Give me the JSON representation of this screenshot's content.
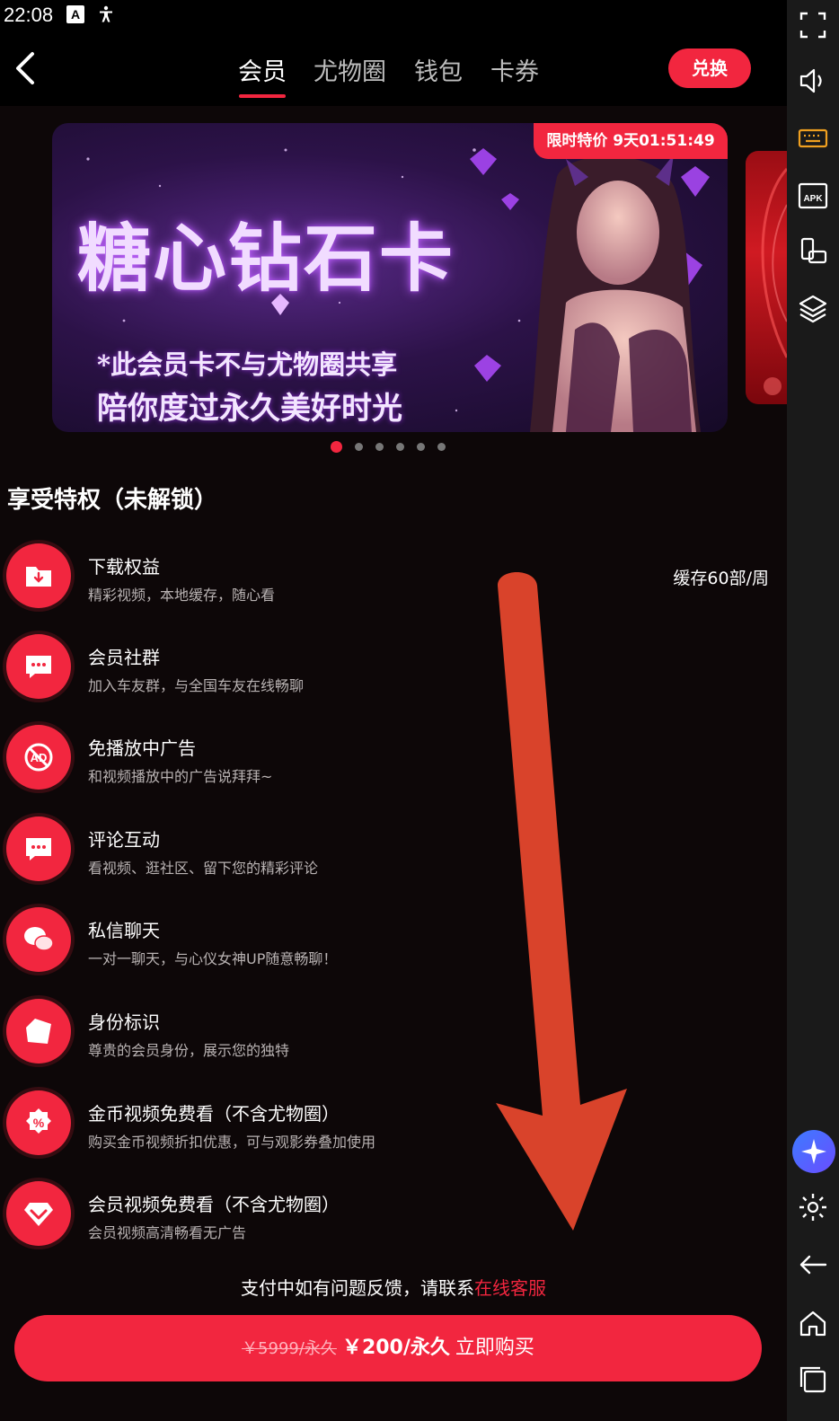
{
  "status_bar": {
    "time": "22:08",
    "icons": [
      "notification-a-icon",
      "accessibility-icon"
    ]
  },
  "nav": {
    "tabs": [
      {
        "label": "会员",
        "active": true
      },
      {
        "label": "尤物圈",
        "active": false
      },
      {
        "label": "钱包",
        "active": false
      },
      {
        "label": "卡券",
        "active": false
      }
    ],
    "redeem_label": "兑换"
  },
  "banner": {
    "badge": "限时特价 9天01:51:49",
    "title": "糖心钻石卡",
    "line1": "*此会员卡不与尤物圈共享",
    "line2": "陪你度过永久美好时光",
    "page_count": 6,
    "active_page": 1
  },
  "privileges": {
    "title": "享受特权（未解锁）",
    "items": [
      {
        "name": "下载权益",
        "desc": "精彩视频，本地缓存，随心看",
        "value": "缓存60部/周",
        "icon": "download-folder-icon"
      },
      {
        "name": "会员社群",
        "desc": "加入车友群，与全国车友在线畅聊",
        "value": "",
        "icon": "chat-bubble-icon"
      },
      {
        "name": "免播放中广告",
        "desc": "和视频播放中的广告说拜拜~",
        "value": "",
        "icon": "no-ad-icon"
      },
      {
        "name": "评论互动",
        "desc": "看视频、逛社区、留下您的精彩评论",
        "value": "",
        "icon": "comment-icon"
      },
      {
        "name": "私信聊天",
        "desc": "一对一聊天，与心仪女神UP随意畅聊！",
        "value": "",
        "icon": "message-bubbles-icon"
      },
      {
        "name": "身份标识",
        "desc": "尊贵的会员身份，展示您的独特",
        "value": "",
        "icon": "identity-tag-icon"
      },
      {
        "name": "金币视频免费看（不含尤物圈）",
        "desc": "购买金币视频折扣优惠，可与观影券叠加使用",
        "value": "",
        "icon": "discount-badge-icon"
      },
      {
        "name": "会员视频免费看（不含尤物圈）",
        "desc": "会员视频高清畅看无广告",
        "value": "",
        "icon": "diamond-icon"
      }
    ]
  },
  "footer": {
    "support_text": "支付中如有问题反馈，请联系",
    "support_link": "在线客服",
    "old_price": "￥5999/永久",
    "new_price": "￥200/永久",
    "cta": "立即购买"
  },
  "colors": {
    "accent": "#f2263f",
    "background": "#0d0708",
    "arrow": "#d9432b"
  },
  "system_rail": [
    "fullscreen-icon",
    "volume-icon",
    "keyboard-icon",
    "apk-icon",
    "multi-window-icon",
    "layers-icon",
    "ai-assistant-icon",
    "settings-icon",
    "back-icon",
    "home-icon",
    "recents-icon"
  ]
}
